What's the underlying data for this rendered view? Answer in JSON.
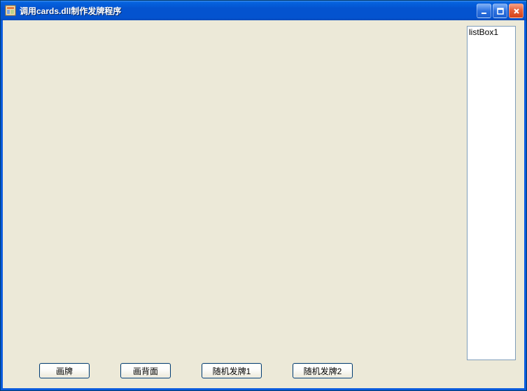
{
  "window": {
    "title": "调用cards.dll制作发牌程序"
  },
  "listbox": {
    "first_item": "listBox1"
  },
  "buttons": {
    "draw": "画牌",
    "back": "画背面",
    "deal1": "随机发牌1",
    "deal2": "随机发牌2"
  }
}
